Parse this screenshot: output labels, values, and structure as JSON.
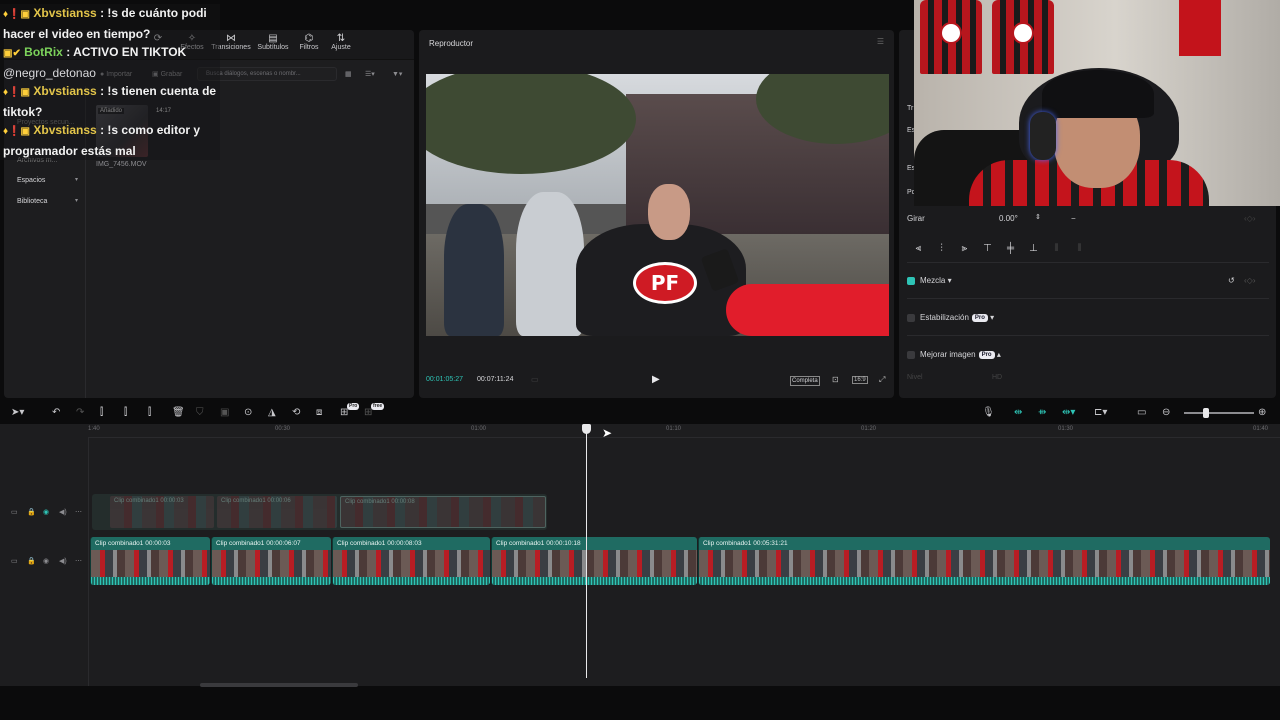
{
  "chat": [
    {
      "badges": "♦❗▣",
      "user": "Xbvstianss",
      "user_color": "#e3c54a",
      "text": ": !s de cuánto podi hacer el video en tiempo?"
    },
    {
      "badges": "▣✔",
      "user": "BotRix",
      "user_color": "#7cd35b",
      "text": ": ACTIVO EN TIKTOK",
      "mention": "@negro_detonao"
    },
    {
      "badges": "♦❗▣",
      "user": "Xbvstianss",
      "user_color": "#e3c54a",
      "text": ": !s tienen cuenta de tiktok?"
    },
    {
      "badges": "♦❗▣",
      "user": "Xbvstianss",
      "user_color": "#e3c54a",
      "text": ": !s como editor y programador estás mal"
    }
  ],
  "media_panel": {
    "tools": [
      {
        "icon": "⟳",
        "label": ""
      },
      {
        "icon": "✧",
        "label": "Efectos"
      },
      {
        "icon": "⋈",
        "label": "Transiciones"
      },
      {
        "icon": "▤",
        "label": "Subtítulos"
      },
      {
        "icon": "⌬",
        "label": "Filtros"
      },
      {
        "icon": "⇅",
        "label": "Ajuste"
      }
    ],
    "import_label": "Importar",
    "record_label": "Grabar",
    "search_placeholder": "Busca diálogos, escenas o nombr...",
    "nav": [
      {
        "label": "Proyectos secun..."
      },
      {
        "label": "Archivos m..."
      },
      {
        "label": "Espacios"
      },
      {
        "label": "Biblioteca"
      }
    ],
    "thumb": {
      "badge": "Añadido",
      "duration": "14:17",
      "name": "IMG_7456.MOV"
    }
  },
  "player": {
    "title": "Reproductor",
    "current_time": "00:01:05:27",
    "total_time": "00:07:11:24",
    "complete_label": "Completa",
    "ratio_label": "16:9",
    "video_badge_text": "PF"
  },
  "properties": {
    "rotate_label": "Girar",
    "rotate_value": "0.00°",
    "blend_label": "Mezcla",
    "stabilization_label": "Estabilización",
    "enhance_label": "Mejorar imagen",
    "pro_label": "Pro",
    "level_label": "Nivel",
    "hd_label": "HD",
    "side_labels": [
      "Tr",
      "Es",
      "Es",
      "Po"
    ]
  },
  "timeline": {
    "ticks": [
      "1:40",
      "00:30",
      "01:00",
      "01:10",
      "01:20",
      "01:30",
      "01:40"
    ],
    "overlay_clips": [
      {
        "label": "Clip combinado1  00:00:03"
      },
      {
        "label": "Clip combinado1  00:00:06"
      },
      {
        "label": "Clip combinado1  00:00:08"
      }
    ],
    "main_clips": [
      {
        "label": "Clip combinado1  00:00:03"
      },
      {
        "label": "Clip combinado1  00:00:06:07"
      },
      {
        "label": "Clip combinado1  00:00:08:03"
      },
      {
        "label": "Clip combinado1  00:00:10:18"
      },
      {
        "label": "Clip combinado1  00:05:31:21"
      }
    ],
    "pro_badge": "Pro",
    "free_badge": "free"
  },
  "colors": {
    "accent": "#2ec4b6",
    "panel": "#1d1d1f",
    "clip": "#1f6b62"
  }
}
